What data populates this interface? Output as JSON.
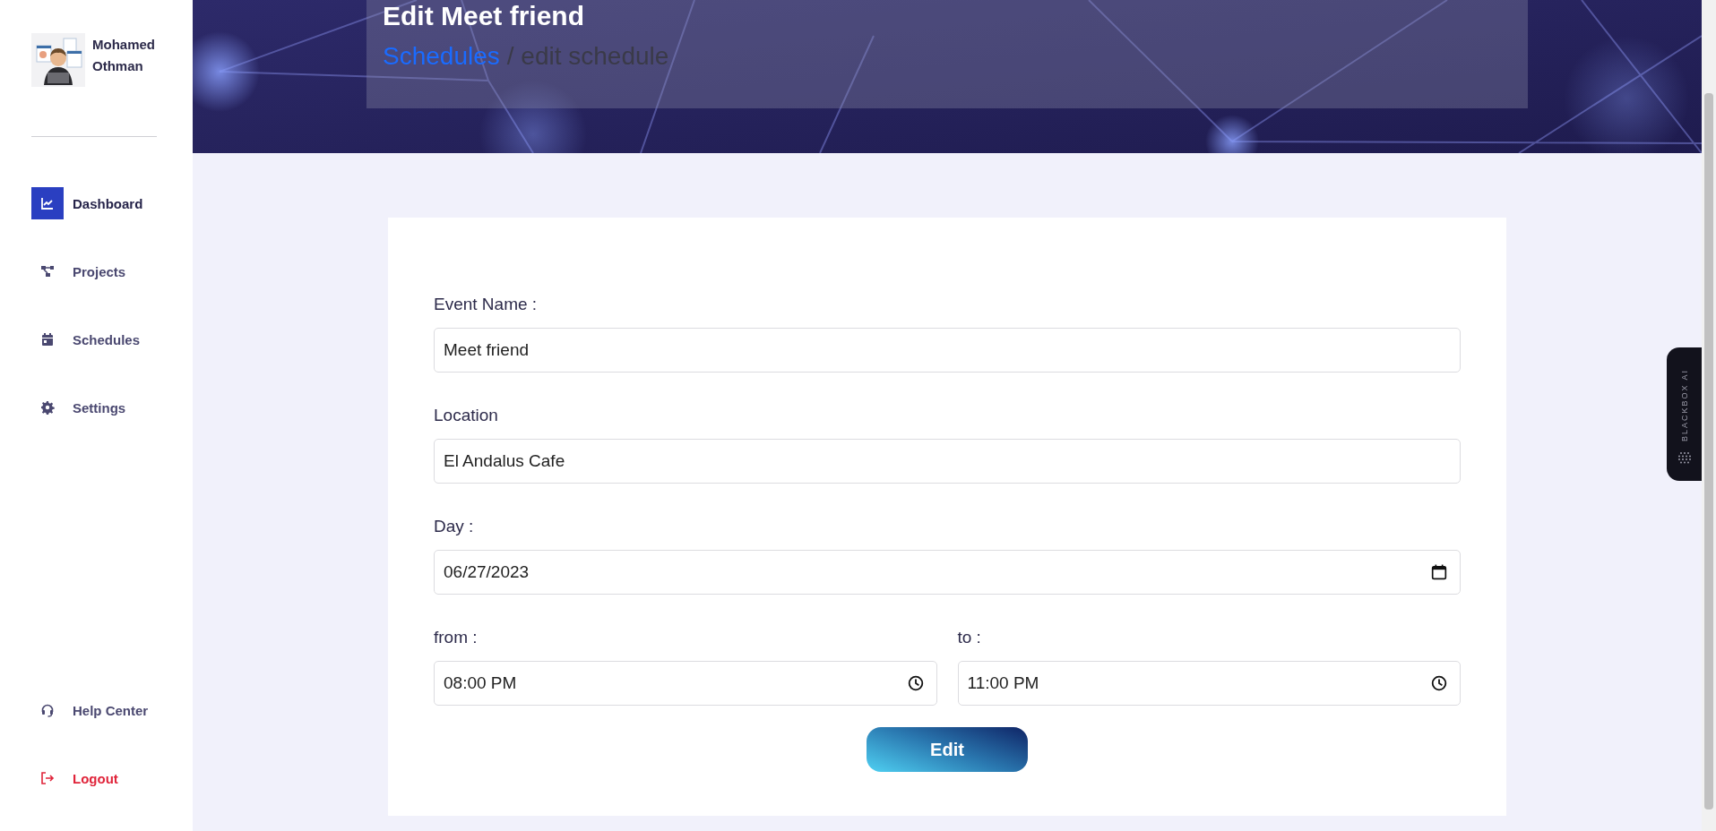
{
  "sidebar": {
    "user": {
      "name": "Mohamed Othman"
    },
    "nav": [
      {
        "label": "Dashboard",
        "kind": "chart",
        "selected": true
      },
      {
        "label": "Projects",
        "kind": "nodes",
        "selected": false
      },
      {
        "label": "Schedules",
        "kind": "calendar",
        "selected": false
      },
      {
        "label": "Settings",
        "kind": "gear",
        "selected": false
      }
    ],
    "bottom": [
      {
        "label": "Help Center",
        "kind": "headset"
      },
      {
        "label": "Logout",
        "kind": "logout"
      }
    ]
  },
  "header": {
    "title": "Edit Meet friend",
    "breadcrumb": [
      {
        "label": "Schedules",
        "kind": "link"
      },
      {
        "label": "/ edit schedule",
        "kind": "text"
      }
    ]
  },
  "form": {
    "fields": [
      {
        "label": "Event Name :",
        "value": "Meet friend",
        "kind": "text"
      },
      {
        "label": "Location",
        "value": "El Andalus Cafe",
        "kind": "text"
      },
      {
        "label": "Day :",
        "value": "06/27/2023",
        "kind": "date"
      }
    ],
    "time_fields": [
      {
        "label": "from :",
        "value": "08:00 PM",
        "kind": "time"
      },
      {
        "label": "to :",
        "value": "11:00 PM",
        "kind": "time"
      }
    ],
    "submit": "Edit"
  },
  "widget": {
    "label": "BLACKBOX AI"
  }
}
